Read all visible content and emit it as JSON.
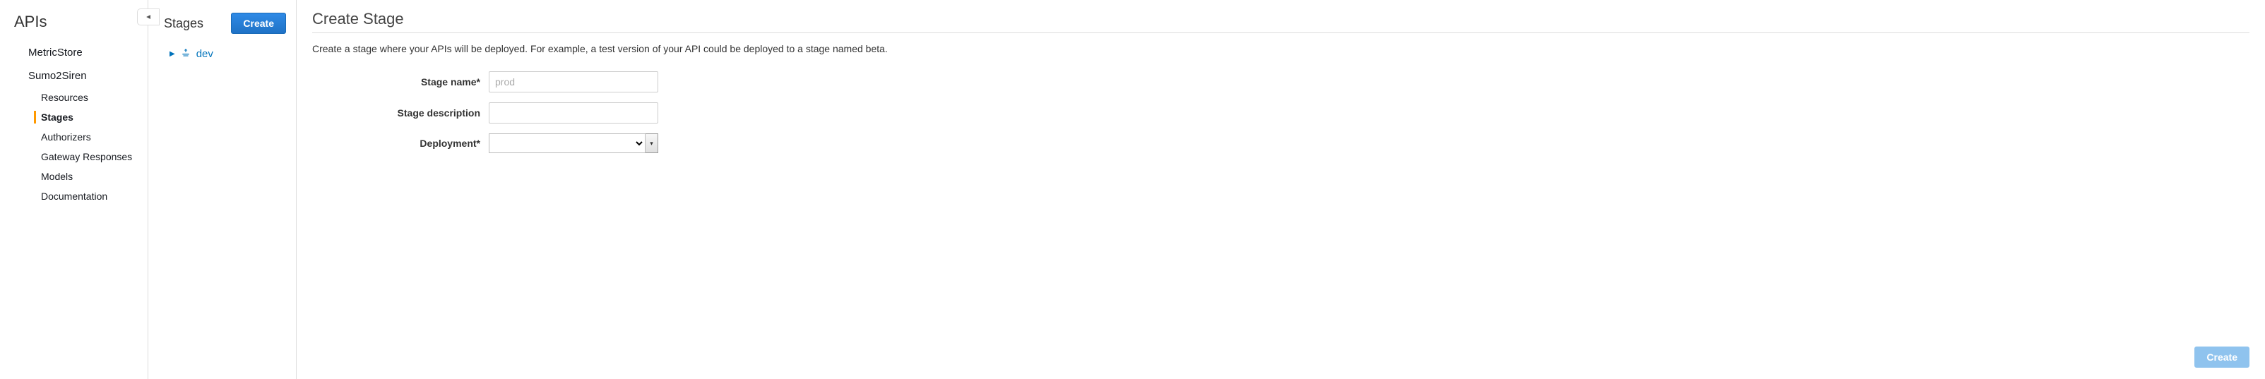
{
  "leftnav": {
    "title": "APIs",
    "apis": [
      {
        "name": "MetricStore"
      },
      {
        "name": "Sumo2Siren"
      }
    ],
    "subitems": [
      {
        "label": "Resources",
        "selected": false
      },
      {
        "label": "Stages",
        "selected": true
      },
      {
        "label": "Authorizers",
        "selected": false
      },
      {
        "label": "Gateway Responses",
        "selected": false
      },
      {
        "label": "Models",
        "selected": false
      },
      {
        "label": "Documentation",
        "selected": false
      }
    ]
  },
  "stagescol": {
    "title": "Stages",
    "create_button": "Create",
    "stages": [
      {
        "name": "dev"
      }
    ]
  },
  "main": {
    "title": "Create Stage",
    "description": "Create a stage where your APIs will be deployed. For example, a test version of your API could be deployed to a stage named beta.",
    "form": {
      "stage_name_label": "Stage name*",
      "stage_name_placeholder": "prod",
      "stage_name_value": "",
      "stage_desc_label": "Stage description",
      "stage_desc_value": "",
      "deployment_label": "Deployment*",
      "deployment_value": ""
    },
    "footer": {
      "create_button": "Create"
    }
  }
}
